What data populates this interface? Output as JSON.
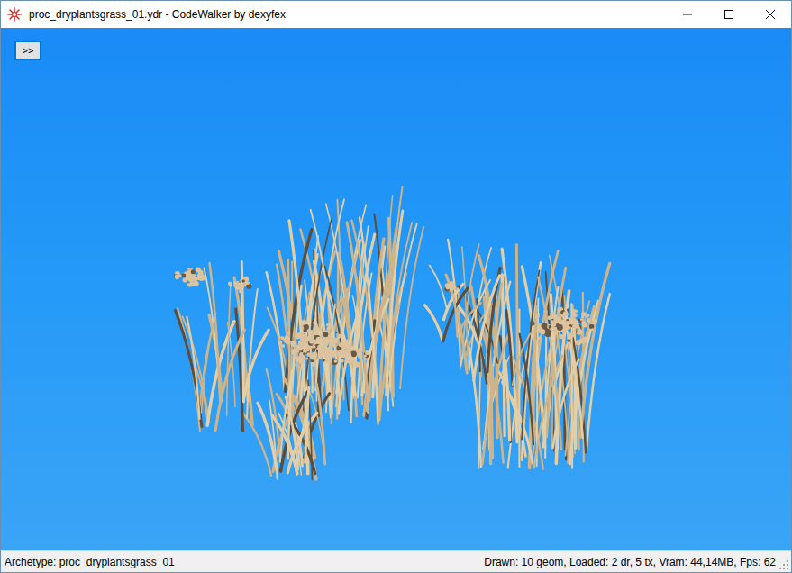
{
  "window": {
    "title": "proc_dryplantsgrass_01.ydr - CodeWalker by dexyfex"
  },
  "toolbar_button": {
    "label": ">>"
  },
  "status_bar": {
    "left": "Archetype: proc_dryplantsgrass_01",
    "right": "Drawn: 10 geom, Loaded: 2 dr, 5 tx, Vram: 44,14MB, Fps: 62"
  }
}
